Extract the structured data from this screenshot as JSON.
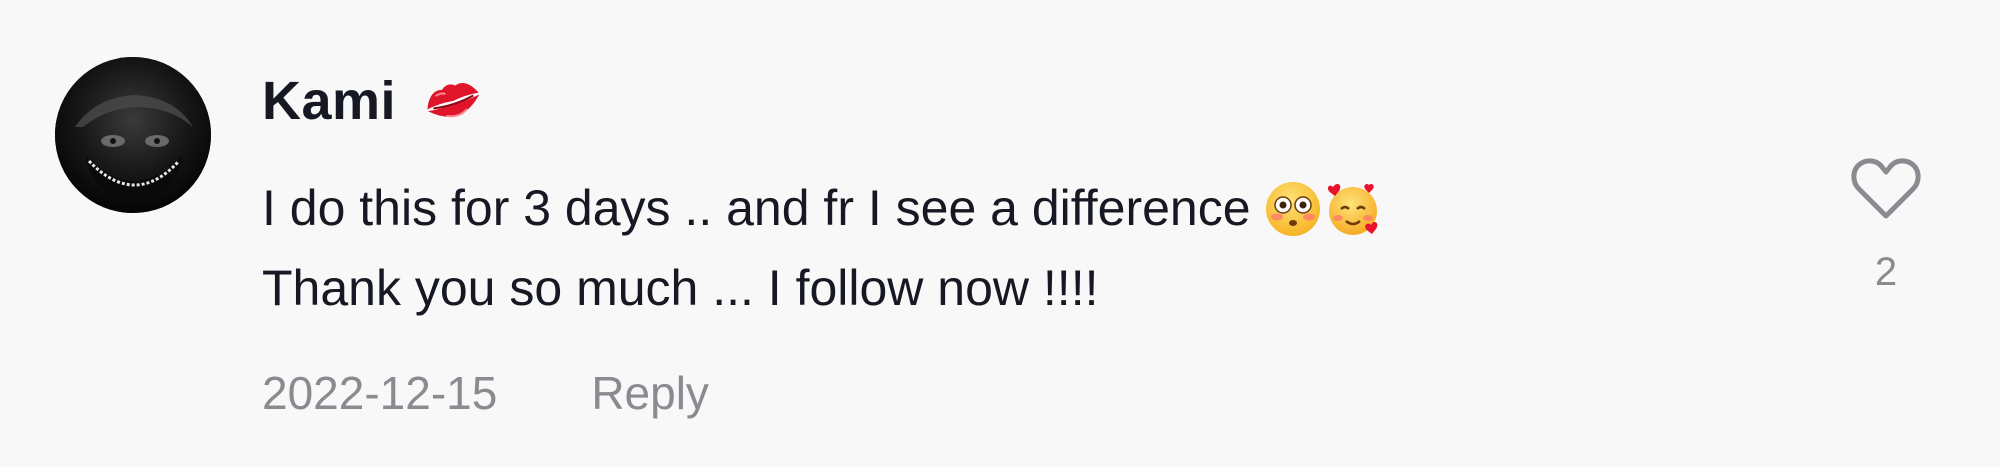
{
  "comment": {
    "author": {
      "name": "Kami",
      "avatar_icon": "avatar-image",
      "badge_icon": "kiss-mark-icon"
    },
    "text_lines": [
      "I do this for 3 days .. and fr I see a difference",
      "Thank you so much ... I follow now !!!!"
    ],
    "emojis": [
      "flushed-face-icon",
      "smiling-face-with-hearts-icon"
    ],
    "date": "2022-12-15",
    "reply_label": "Reply",
    "like": {
      "icon": "heart-outline-icon",
      "count": "2"
    }
  },
  "colors": {
    "background": "#f8f8f8",
    "text_primary": "#161823",
    "text_secondary": "#8a8b91",
    "lips": "#e0152b"
  }
}
